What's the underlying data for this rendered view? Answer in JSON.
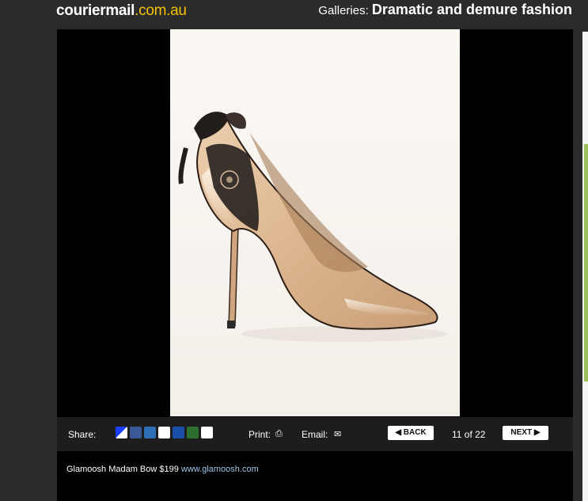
{
  "header": {
    "logo_main": "couriermail",
    "logo_tld": ".com.au",
    "gallery_prefix": "Galleries:",
    "gallery_name": "Dramatic and demure fashion"
  },
  "toolbar": {
    "share_label": "Share:",
    "share_icons": [
      "delicious-icon",
      "facebook-icon",
      "digg-icon",
      "kwoff-icon",
      "myspace-icon",
      "newsvine-icon",
      "help-icon"
    ],
    "print_label": "Print:",
    "email_label": "Email:",
    "back_label": "BACK",
    "counter": "11 of 22",
    "next_label": "NEXT"
  },
  "caption": {
    "text": "Glamoosh Madam Bow $199",
    "link": "www.glamoosh.com"
  },
  "colors": {
    "brand_accent": "#f3c300",
    "link": "#9cc3e8"
  }
}
